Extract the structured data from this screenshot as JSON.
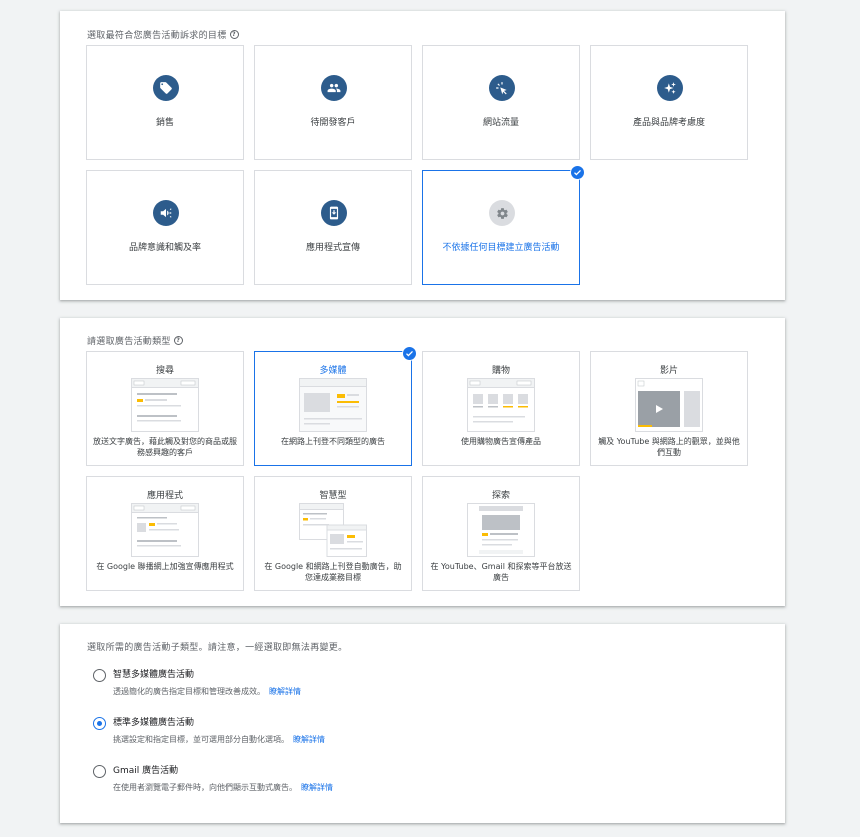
{
  "goal_section": {
    "prompt": "選取最符合您廣告活動訴求的目標",
    "goals": [
      {
        "label": "銷售",
        "icon": "tag-icon"
      },
      {
        "label": "待開發客戶",
        "icon": "people-icon"
      },
      {
        "label": "網站流量",
        "icon": "cursor-click-icon"
      },
      {
        "label": "產品與品牌考慮度",
        "icon": "sparkle-icon"
      },
      {
        "label": "品牌意識和觸及率",
        "icon": "megaphone-icon"
      },
      {
        "label": "應用程式宣傳",
        "icon": "phone-download-icon"
      },
      {
        "label": "不依據任何目標建立廣告活動",
        "icon": "gear-icon",
        "selected": true
      }
    ]
  },
  "type_section": {
    "prompt": "請選取廣告活動類型",
    "types": [
      {
        "label": "搜尋",
        "desc": "放送文字廣告，藉此觸及對您的商品或服務感興趣的客戶"
      },
      {
        "label": "多媒體",
        "desc": "在網路上刊登不同類型的廣告",
        "selected": true
      },
      {
        "label": "購物",
        "desc": "使用購物廣告宣傳產品"
      },
      {
        "label": "影片",
        "desc": "觸及 YouTube 與網路上的觀眾，並與他們互動"
      },
      {
        "label": "應用程式",
        "desc": "在 Google 聯播網上加強宣傳應用程式"
      },
      {
        "label": "智慧型",
        "desc": "在 Google 和網路上刊登自動廣告，助您達成業務目標"
      },
      {
        "label": "探索",
        "desc": "在 YouTube、Gmail 和探索等平台放送廣告"
      }
    ]
  },
  "subtype_section": {
    "prompt": "選取所需的廣告活動子類型。請注意，一經選取即無法再變更。",
    "options": [
      {
        "title": "智慧多媒體廣告活動",
        "desc": "透過簡化的廣告指定目標和管理改善成效。",
        "link": "瞭解詳情",
        "selected": false
      },
      {
        "title": "標準多媒體廣告活動",
        "desc": "挑選設定和指定目標，並可選用部分自動化選項。",
        "link": "瞭解詳情",
        "selected": true
      },
      {
        "title": "Gmail 廣告活動",
        "desc": "在使用者瀏覽電子郵件時，向他們顯示互動式廣告。",
        "link": "瞭解詳情",
        "selected": false
      }
    ]
  },
  "colors": {
    "accent": "#1a73e8",
    "icon_circle": "#2d5c8c",
    "ad_highlight": "#fbbc04"
  }
}
